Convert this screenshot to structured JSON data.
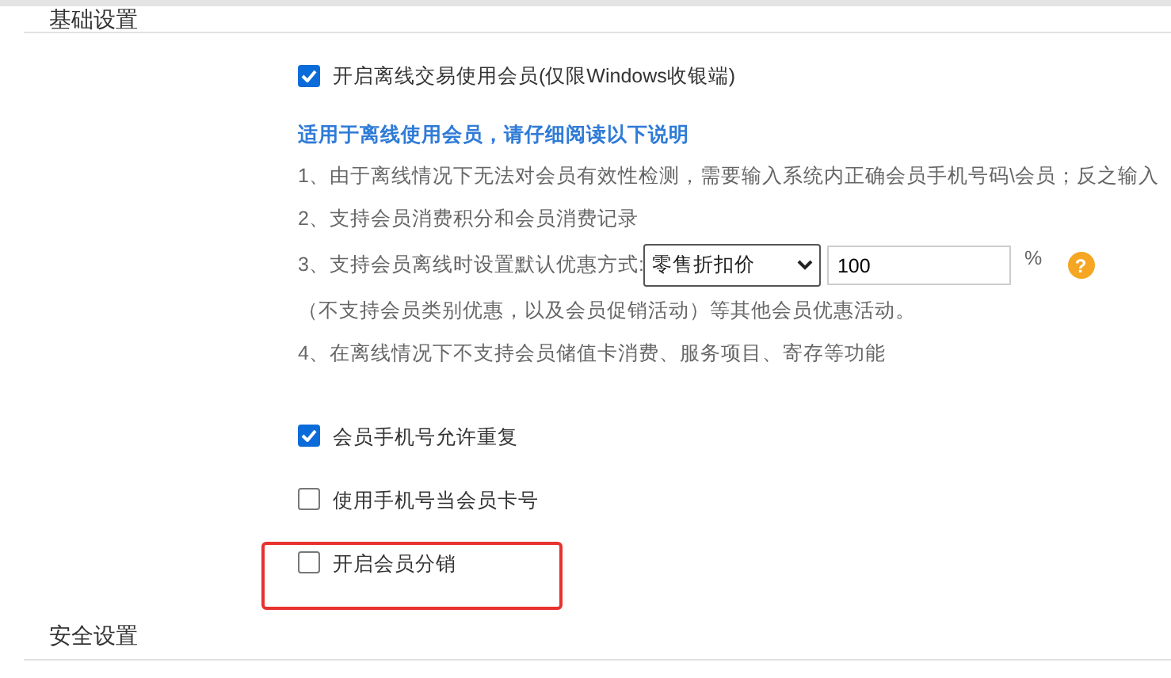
{
  "sections": [
    {
      "title": "基础设置"
    },
    {
      "title": "安全设置"
    }
  ],
  "offline_option": {
    "label": "开启离线交易使用会员(仅限Windows收银端)",
    "checked": true
  },
  "notice_title": "适用于离线使用会员，请仔细阅读以下说明",
  "notes": [
    {
      "kind": "text",
      "text": "1、由于离线情况下无法对会员有效性检测，需要输入系统内正确会员手机号码\\会员；反之输入"
    },
    {
      "kind": "text",
      "text": "2、支持会员消费积分和会员消费记录"
    },
    {
      "kind": "discount",
      "text": "3、支持会员离线时设置默认优惠方式:",
      "select_value": "零售折扣价",
      "input_value": "100",
      "unit": "%",
      "help": "?"
    },
    {
      "kind": "text",
      "text": "（不支持会员类别优惠，以及会员促销活动）等其他会员优惠活动。"
    },
    {
      "kind": "text",
      "text": "4、在离线情况下不支持会员储值卡消费、服务项目、寄存等功能"
    }
  ],
  "options": [
    {
      "label": "会员手机号允许重复",
      "checked": true,
      "highlighted": false
    },
    {
      "label": "使用手机号当会员卡号",
      "checked": false,
      "highlighted": false
    },
    {
      "label": "开启会员分销",
      "checked": false,
      "highlighted": true
    }
  ]
}
